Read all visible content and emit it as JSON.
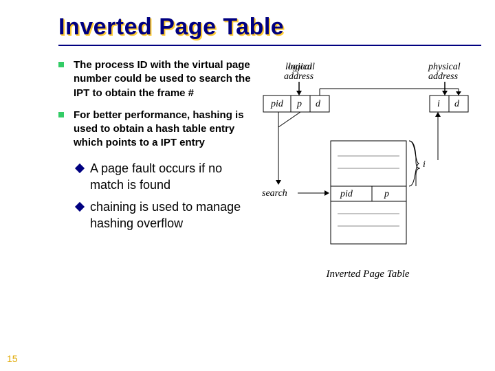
{
  "title": "Inverted Page Table",
  "bullets": [
    "The process ID with the virtual page number could be used to search the IPT to obtain the frame #",
    "For better performance, hashing is used to obtain a hash table entry which points to a IPT entry"
  ],
  "subbullets": [
    "A page fault occurs if no match is found",
    "chaining is used to manage hashing overflow"
  ],
  "diagram": {
    "logical_label": "logical\naddress",
    "physical_label": "physical\naddress",
    "pid": "pid",
    "p": "p",
    "d": "d",
    "i": "i",
    "search": "search",
    "caption": "Inverted Page Table"
  },
  "page_number": "15"
}
